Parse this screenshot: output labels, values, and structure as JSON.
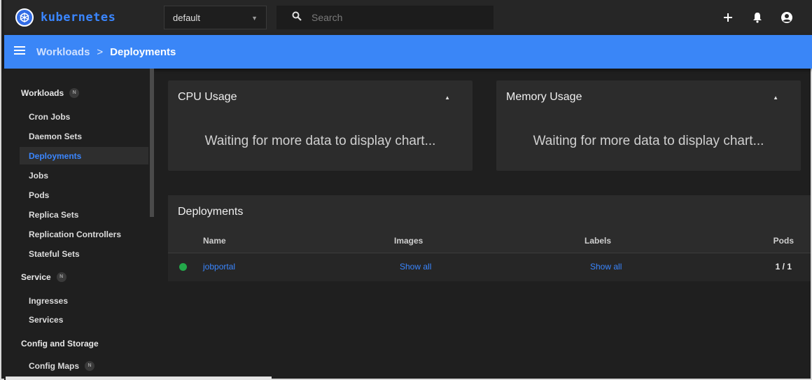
{
  "app": {
    "brand": "kubernetes",
    "accent": "#3a86f7",
    "logo_icon": "kubernetes-helm-icon"
  },
  "topbar": {
    "namespace": "default",
    "search_placeholder": "Search",
    "icons": [
      "add-icon",
      "bell-icon",
      "account-icon"
    ]
  },
  "breadcrumb": {
    "parent": "Workloads",
    "separator": ">",
    "current": "Deployments"
  },
  "sidebar": {
    "sections": [
      {
        "label": "Workloads",
        "badge": "N"
      },
      {
        "label": "Service",
        "badge": "N"
      },
      {
        "label": "Config and Storage"
      }
    ],
    "workloads_items": [
      "Cron Jobs",
      "Daemon Sets",
      "Deployments",
      "Jobs",
      "Pods",
      "Replica Sets",
      "Replication Controllers",
      "Stateful Sets"
    ],
    "service_items": [
      "Ingresses",
      "Services"
    ],
    "config_items": [
      {
        "label": "Config Maps",
        "badge": "N"
      }
    ],
    "active_item": "Deployments"
  },
  "cpu_card": {
    "title": "CPU Usage",
    "message": "Waiting for more data to display chart..."
  },
  "memory_card": {
    "title": "Memory Usage",
    "message": "Waiting for more data to display chart..."
  },
  "deployments": {
    "title": "Deployments",
    "columns": [
      "Name",
      "Images",
      "Labels",
      "Pods"
    ],
    "rows": [
      {
        "status": "running",
        "status_color": "#23a84a",
        "name": "jobportal",
        "images": "Show all",
        "labels": "Show all",
        "pods": "1 / 1"
      }
    ]
  }
}
